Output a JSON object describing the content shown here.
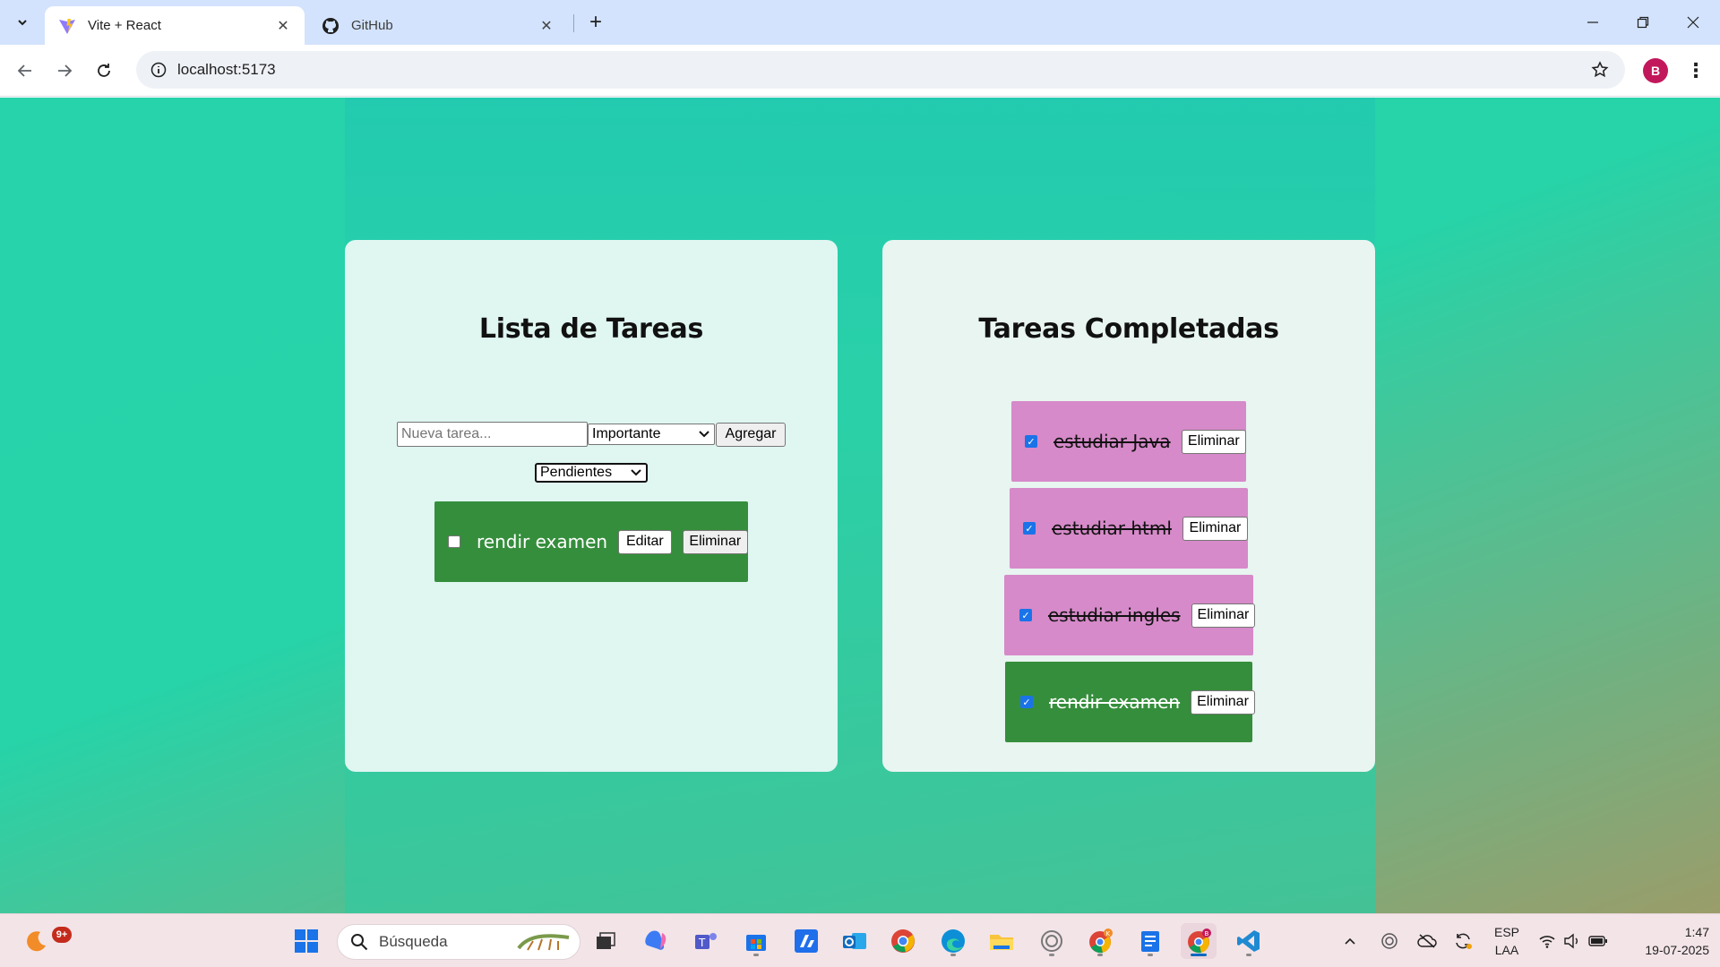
{
  "browser": {
    "tabs": [
      {
        "title": "Vite + React",
        "icon": "vite-icon",
        "active": true
      },
      {
        "title": "GitHub",
        "icon": "github-icon",
        "active": false
      }
    ],
    "url": "localhost:5173",
    "profile_initial": "B"
  },
  "app": {
    "todo_panel": {
      "title": "Lista de Tareas",
      "input_placeholder": "Nueva tarea...",
      "priority_selected": "Importante",
      "add_label": "Agregar",
      "filter_selected": "Pendientes",
      "tasks": [
        {
          "text": "rendir examen",
          "done": false,
          "color": "#358e3c",
          "edit_label": "Editar",
          "delete_label": "Eliminar"
        }
      ]
    },
    "done_panel": {
      "title": "Tareas Completadas",
      "tasks": [
        {
          "text": "estudiar Java",
          "done": true,
          "color": "#d68ac9",
          "delete_label": "Eliminar"
        },
        {
          "text": "estudiar html",
          "done": true,
          "color": "#d68ac9",
          "delete_label": "Eliminar"
        },
        {
          "text": "estudiar ingles",
          "done": true,
          "color": "#d68ac9",
          "delete_label": "Eliminar"
        },
        {
          "text": "rendir examen",
          "done": true,
          "color": "#358e3c",
          "delete_label": "Eliminar"
        }
      ]
    }
  },
  "taskbar": {
    "search_label": "Búsqueda",
    "notification_badge": "9+",
    "language": "ESP",
    "keyboard": "LAA",
    "time": "1:47",
    "date": "19-07-2025"
  }
}
